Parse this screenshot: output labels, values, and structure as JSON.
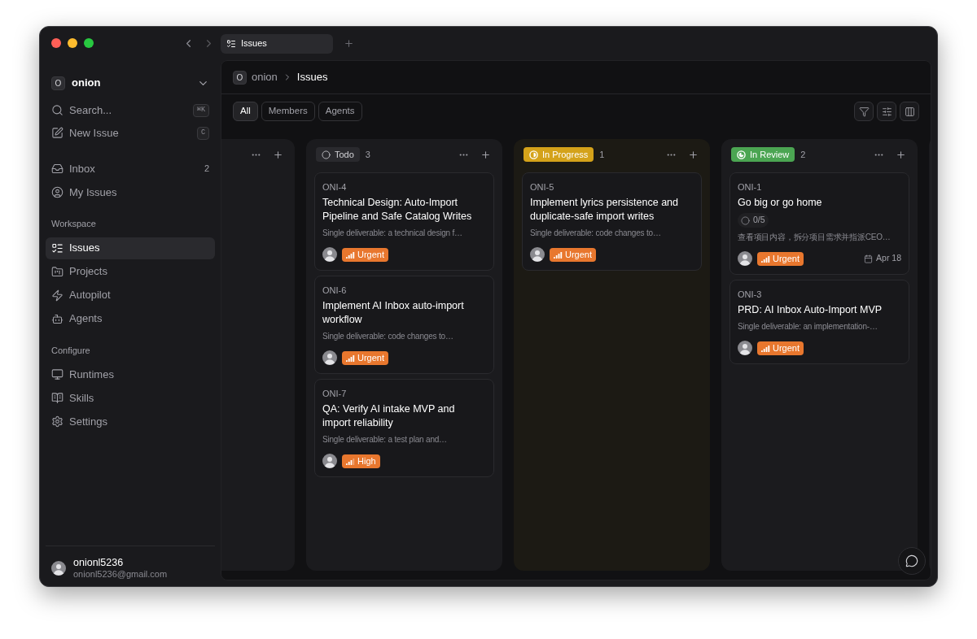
{
  "window": {
    "tab": {
      "label": "Issues"
    }
  },
  "sidebar": {
    "workspace": {
      "initial": "O",
      "name": "onion"
    },
    "actions": [
      {
        "kind": "search",
        "label": "Search...",
        "shortcut": "⌘K"
      },
      {
        "kind": "new",
        "label": "New Issue",
        "shortcut": "C"
      }
    ],
    "top_items": [
      {
        "kind": "inbox",
        "label": "Inbox",
        "count": "2",
        "selected": false
      },
      {
        "kind": "my",
        "label": "My Issues",
        "selected": false
      }
    ],
    "sections": [
      {
        "title": "Workspace",
        "items": [
          {
            "kind": "issues",
            "label": "Issues",
            "selected": true
          },
          {
            "kind": "projects",
            "label": "Projects",
            "selected": false
          },
          {
            "kind": "autopilot",
            "label": "Autopilot",
            "selected": false
          },
          {
            "kind": "agents",
            "label": "Agents",
            "selected": false
          }
        ]
      },
      {
        "title": "Configure",
        "items": [
          {
            "kind": "runtimes",
            "label": "Runtimes",
            "selected": false
          },
          {
            "kind": "skills",
            "label": "Skills",
            "selected": false
          },
          {
            "kind": "settings",
            "label": "Settings",
            "selected": false
          }
        ]
      }
    ],
    "user": {
      "name": "onionl5236",
      "email": "onionl5236@gmail.com"
    }
  },
  "breadcrumb": {
    "initial": "O",
    "workspace": "onion",
    "page": "Issues"
  },
  "filters": [
    {
      "label": "All",
      "selected": true
    },
    {
      "label": "Members",
      "selected": false
    },
    {
      "label": "Agents",
      "selected": false
    }
  ],
  "columns": [
    {
      "kind": "clipped"
    },
    {
      "kind": "todo",
      "label": "Todo",
      "count": "3",
      "cards": [
        {
          "id": "ONI-4",
          "title": "Technical Design: Auto-Import Pipeline and Safe Catalog Writes",
          "description": "Single deliverable: a technical design f…",
          "priority": {
            "kind": "urgent",
            "label": "Urgent"
          }
        },
        {
          "id": "ONI-6",
          "title": "Implement AI Inbox auto-import workflow",
          "description": "Single deliverable: code changes to…",
          "priority": {
            "kind": "urgent",
            "label": "Urgent"
          }
        },
        {
          "id": "ONI-7",
          "title": "QA: Verify AI intake MVP and import reliability",
          "description": "Single deliverable: a test plan and…",
          "priority": {
            "kind": "high",
            "label": "High"
          }
        }
      ]
    },
    {
      "kind": "in_progress",
      "label": "In Progress",
      "count": "1",
      "cards": [
        {
          "id": "ONI-5",
          "title": "Implement lyrics persistence and duplicate-safe import writes",
          "description": "Single deliverable: code changes to…",
          "priority": {
            "kind": "urgent",
            "label": "Urgent"
          }
        }
      ]
    },
    {
      "kind": "in_review",
      "label": "In Review",
      "count": "2",
      "cards": [
        {
          "id": "ONI-1",
          "title": "Go big or go home",
          "subtasks": "0/5",
          "description": "查看项目内容，拆分项目需求并指派CEO…",
          "priority": {
            "kind": "urgent",
            "label": "Urgent"
          },
          "due": "Apr 18"
        },
        {
          "id": "ONI-3",
          "title": "PRD: AI Inbox Auto-Import MVP",
          "description": "Single deliverable: an implementation-…",
          "priority": {
            "kind": "urgent",
            "label": "Urgent"
          }
        }
      ]
    },
    {
      "kind": "clipped"
    }
  ]
}
